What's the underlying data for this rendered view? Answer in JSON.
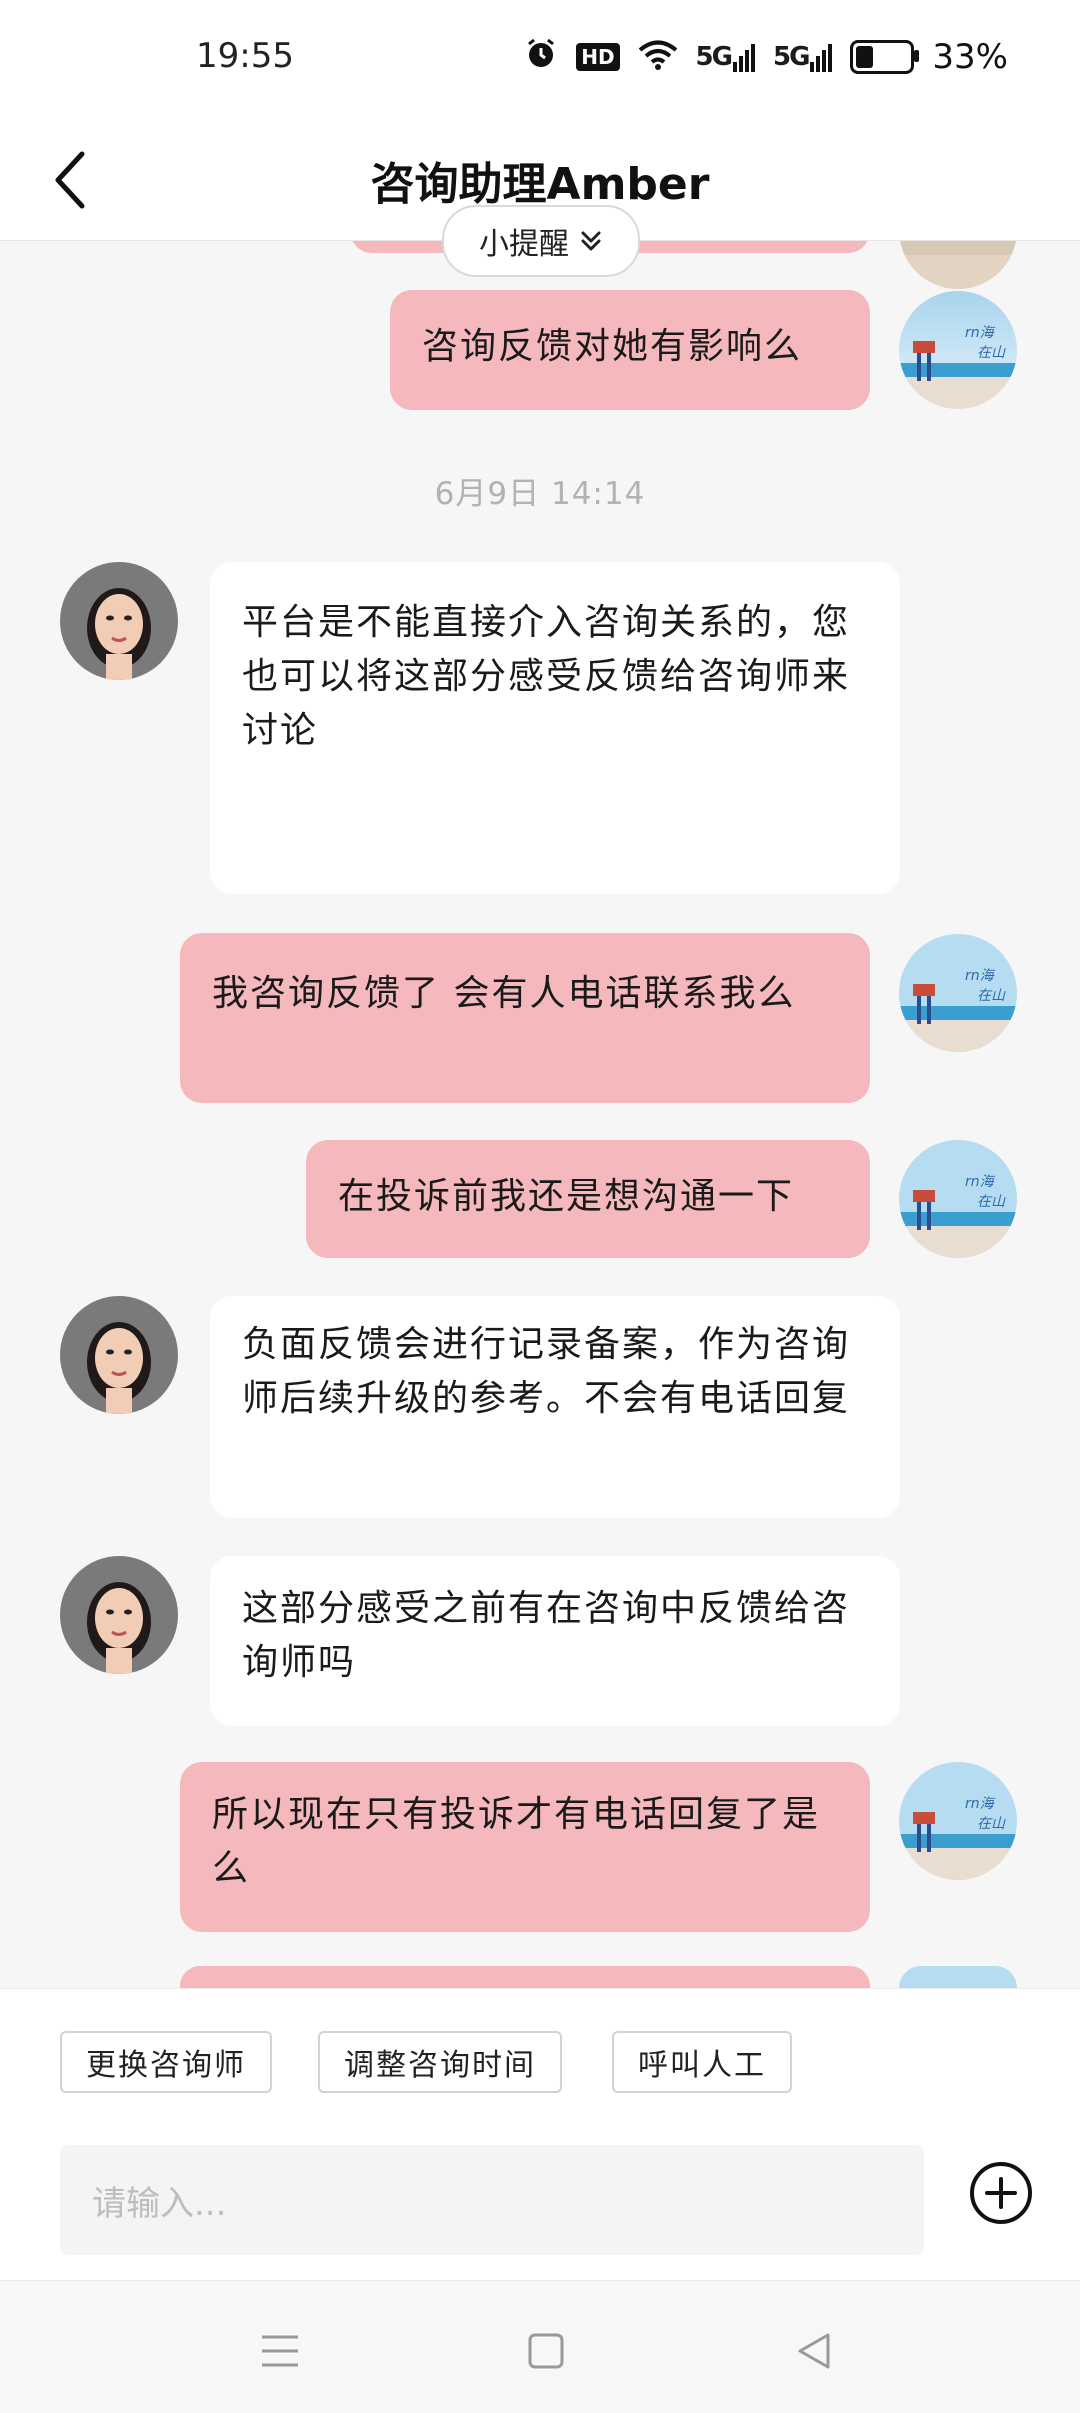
{
  "status_bar": {
    "time": "19:55",
    "hd_label": "HD",
    "signal1_label": "5G",
    "signal2_label": "5G",
    "battery_percent": "33%",
    "battery_level": 0.33
  },
  "header": {
    "title": "咨询助理Amber"
  },
  "reminder": {
    "label": "小提醒"
  },
  "timestamp": "6月9日  14:14",
  "messages": [
    {
      "from": "me",
      "text": "咨询反馈对她有影响么"
    },
    {
      "from": "assistant",
      "text": "平台是不能直接介入咨询关系的，您也可以将这部分感受反馈给咨询师来讨论"
    },
    {
      "from": "me",
      "text": "我咨询反馈了 会有人电话联系我么"
    },
    {
      "from": "me",
      "text": "在投诉前我还是想沟通一下"
    },
    {
      "from": "assistant",
      "text": "负面反馈会进行记录备案，作为咨询师后续升级的参考。不会有电话回复"
    },
    {
      "from": "assistant",
      "text": "这部分感受之前有在咨询中反馈给咨询师吗"
    },
    {
      "from": "me",
      "text": "所以现在只有投诉才有电话回复了是么"
    }
  ],
  "quick_actions": [
    "更换咨询师",
    "调整咨询时间",
    "呼叫人工"
  ],
  "input": {
    "placeholder": "请输入..."
  },
  "colors": {
    "my_bubble": "#f5b8bc",
    "their_bubble": "#ffffff",
    "background": "#f6f6f6"
  }
}
